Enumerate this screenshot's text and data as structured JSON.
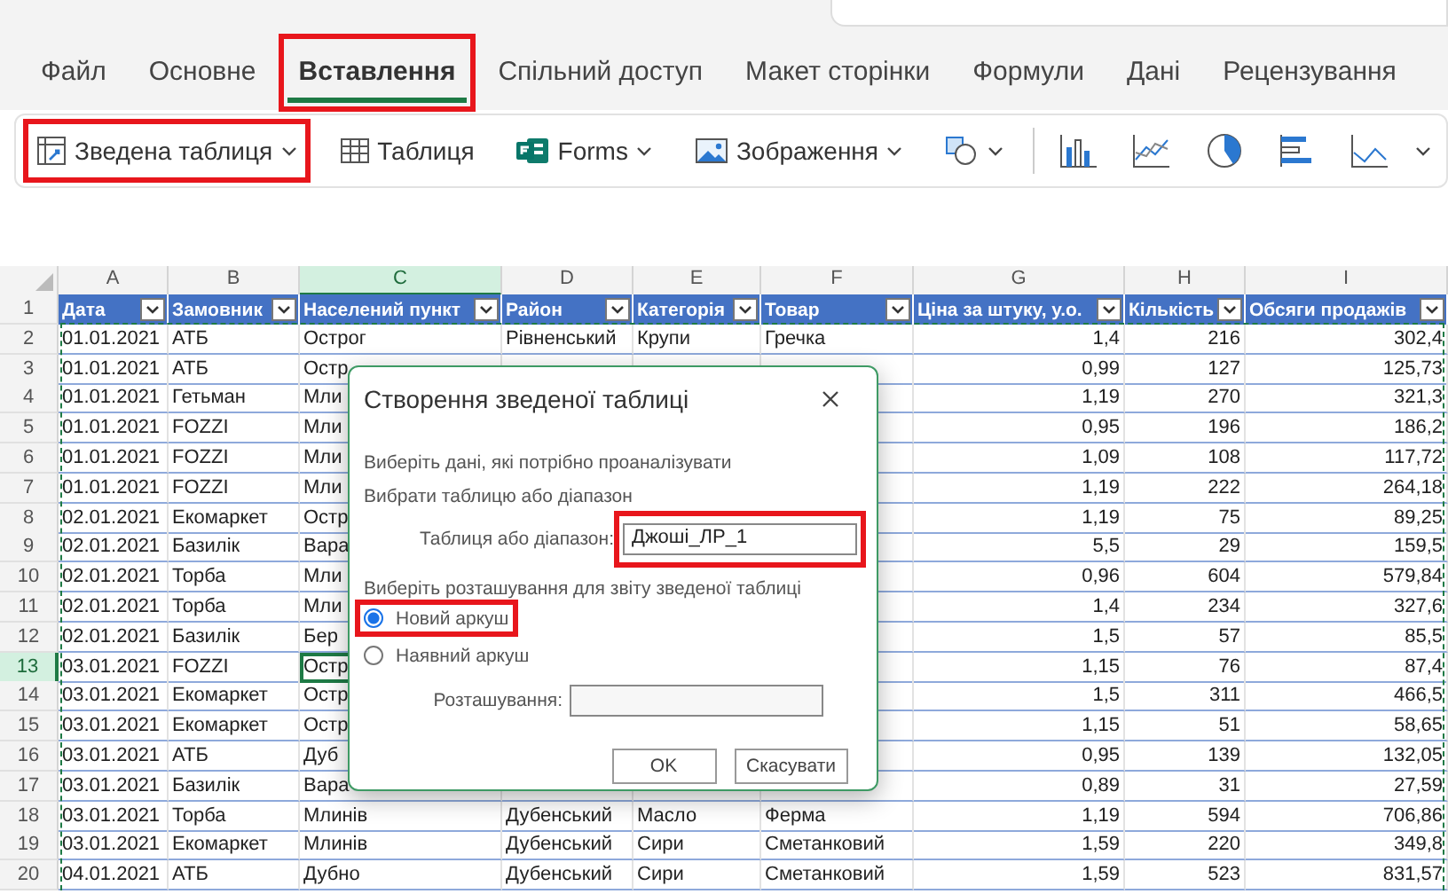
{
  "tabs": [
    {
      "label": "Файл",
      "selected": false,
      "highlighted": false
    },
    {
      "label": "Основне",
      "selected": false,
      "highlighted": false
    },
    {
      "label": "Вставлення",
      "selected": true,
      "highlighted": true
    },
    {
      "label": "Спільний доступ",
      "selected": false,
      "highlighted": false
    },
    {
      "label": "Макет сторінки",
      "selected": false,
      "highlighted": false
    },
    {
      "label": "Формули",
      "selected": false,
      "highlighted": false
    },
    {
      "label": "Дані",
      "selected": false,
      "highlighted": false
    },
    {
      "label": "Рецензування",
      "selected": false,
      "highlighted": false
    }
  ],
  "ribbon": {
    "tools": [
      {
        "kind": "pivot",
        "label": "Зведена таблиця",
        "menu": true,
        "highlighted": true
      },
      {
        "kind": "table",
        "label": "Таблиця",
        "menu": false,
        "highlighted": false
      },
      {
        "kind": "forms",
        "label": "Forms",
        "menu": true,
        "highlighted": false
      },
      {
        "kind": "picture",
        "label": "Зображення",
        "menu": true,
        "highlighted": false
      },
      {
        "kind": "shapes",
        "menu": true,
        "highlighted": false
      }
    ],
    "charts": [
      {
        "kind": "column"
      },
      {
        "kind": "line"
      },
      {
        "kind": "pie"
      },
      {
        "kind": "bar"
      },
      {
        "kind": "area"
      }
    ]
  },
  "sheet": {
    "columns": [
      {
        "letter": "A",
        "selected": false,
        "kind": "text"
      },
      {
        "letter": "B",
        "selected": false,
        "kind": "text"
      },
      {
        "letter": "C",
        "selected": true,
        "kind": "text"
      },
      {
        "letter": "D",
        "selected": false,
        "kind": "text"
      },
      {
        "letter": "E",
        "selected": false,
        "kind": "text"
      },
      {
        "letter": "F",
        "selected": false,
        "kind": "text"
      },
      {
        "letter": "G",
        "selected": false,
        "kind": "number"
      },
      {
        "letter": "H",
        "selected": false,
        "kind": "number"
      },
      {
        "letter": "I",
        "selected": false,
        "kind": "number"
      }
    ],
    "header_row": {
      "n": "1",
      "cells": [
        "Дата",
        "Замовник",
        "Населений пункт",
        "Район",
        "Категорія",
        "Товар",
        "Ціна за штуку, у.о.",
        "Кількість",
        "Обсяги продажів"
      ]
    },
    "rows": [
      {
        "n": "2",
        "selected": false,
        "cells": {
          "A": "01.01.2021",
          "B": "АТБ",
          "C": "Острог",
          "D": "Рівненський",
          "E": "Крупи",
          "F": "Гречка",
          "G": "1,4",
          "H": "216",
          "I": "302,4"
        }
      },
      {
        "n": "3",
        "selected": false,
        "cells": {
          "A": "01.01.2021",
          "B": "АТБ",
          "C": "Остр",
          "G": "0,99",
          "H": "127",
          "I": "125,73"
        }
      },
      {
        "n": "4",
        "selected": false,
        "cells": {
          "A": "01.01.2021",
          "B": "Гетьман",
          "C": "Мли",
          "G": "1,19",
          "H": "270",
          "I": "321,3"
        }
      },
      {
        "n": "5",
        "selected": false,
        "cells": {
          "A": "01.01.2021",
          "B": "FOZZI",
          "C": "Мли",
          "G": "0,95",
          "H": "196",
          "I": "186,2"
        }
      },
      {
        "n": "6",
        "selected": false,
        "cells": {
          "A": "01.01.2021",
          "B": "FOZZI",
          "C": "Мли",
          "G": "1,09",
          "H": "108",
          "I": "117,72"
        }
      },
      {
        "n": "7",
        "selected": false,
        "cells": {
          "A": "01.01.2021",
          "B": "FOZZI",
          "C": "Мли",
          "G": "1,19",
          "H": "222",
          "I": "264,18"
        }
      },
      {
        "n": "8",
        "selected": false,
        "cells": {
          "A": "02.01.2021",
          "B": "Екомаркет",
          "C": "Остр",
          "G": "1,19",
          "H": "75",
          "I": "89,25"
        }
      },
      {
        "n": "9",
        "selected": false,
        "cells": {
          "A": "02.01.2021",
          "B": "Базилік",
          "C": "Вара",
          "G": "5,5",
          "H": "29",
          "I": "159,5"
        }
      },
      {
        "n": "10",
        "selected": false,
        "cells": {
          "A": "02.01.2021",
          "B": "Торба",
          "C": "Мли",
          "G": "0,96",
          "H": "604",
          "I": "579,84"
        }
      },
      {
        "n": "11",
        "selected": false,
        "cells": {
          "A": "02.01.2021",
          "B": "Торба",
          "C": "Мли",
          "G": "1,4",
          "H": "234",
          "I": "327,6"
        }
      },
      {
        "n": "12",
        "selected": false,
        "cells": {
          "A": "02.01.2021",
          "B": "Базилік",
          "C": "Бер",
          "G": "1,5",
          "H": "57",
          "I": "85,5"
        }
      },
      {
        "n": "13",
        "selected": true,
        "cells": {
          "A": "03.01.2021",
          "B": "FOZZI",
          "C": "Остр",
          "G": "1,15",
          "H": "76",
          "I": "87,4"
        }
      },
      {
        "n": "14",
        "selected": false,
        "cells": {
          "A": "03.01.2021",
          "B": "Екомаркет",
          "C": "Остр",
          "G": "1,5",
          "H": "311",
          "I": "466,5"
        }
      },
      {
        "n": "15",
        "selected": false,
        "cells": {
          "A": "03.01.2021",
          "B": "Екомаркет",
          "C": "Остр",
          "G": "1,15",
          "H": "51",
          "I": "58,65"
        }
      },
      {
        "n": "16",
        "selected": false,
        "cells": {
          "A": "03.01.2021",
          "B": "АТБ",
          "C": "Дуб",
          "G": "0,95",
          "H": "139",
          "I": "132,05"
        }
      },
      {
        "n": "17",
        "selected": false,
        "cells": {
          "A": "03.01.2021",
          "B": "Базилік",
          "C": "Вара",
          "G": "0,89",
          "H": "31",
          "I": "27,59"
        }
      },
      {
        "n": "18",
        "selected": false,
        "cells": {
          "A": "03.01.2021",
          "B": "Торба",
          "C": "Млинів",
          "D": "Дубенський",
          "E": "Масло",
          "F": "Ферма",
          "G": "1,19",
          "H": "594",
          "I": "706,86"
        }
      },
      {
        "n": "19",
        "selected": false,
        "cells": {
          "A": "03.01.2021",
          "B": "Екомаркет",
          "C": "Млинів",
          "D": "Дубенський",
          "E": "Сири",
          "F": "Сметанковий",
          "G": "1,59",
          "H": "220",
          "I": "349,8"
        }
      },
      {
        "n": "20",
        "selected": false,
        "cells": {
          "A": "04.01.2021",
          "B": "АТБ",
          "C": "Дубно",
          "D": "Дубенський",
          "E": "Сири",
          "F": "Сметанковий",
          "G": "1,59",
          "H": "523",
          "I": "831,57"
        }
      }
    ]
  },
  "dialog": {
    "title": "Створення зведеної таблиці",
    "prompt": "Виберіть дані, які потрібно проаналізувати",
    "source_heading": "Вибрати таблицю або діапазон",
    "range_label": "Таблиця або діапазон:",
    "range_value": "Джоші_ЛР_1",
    "range_highlighted": true,
    "location_prompt": "Виберіть розташування для звіту зведеної таблиці",
    "options": [
      {
        "label": "Новий аркуш",
        "selected": true,
        "highlighted": true
      },
      {
        "label": "Наявний аркуш",
        "selected": false,
        "highlighted": false
      }
    ],
    "location_label": "Розташування:",
    "buttons": [
      "OK",
      "Скасувати"
    ]
  }
}
